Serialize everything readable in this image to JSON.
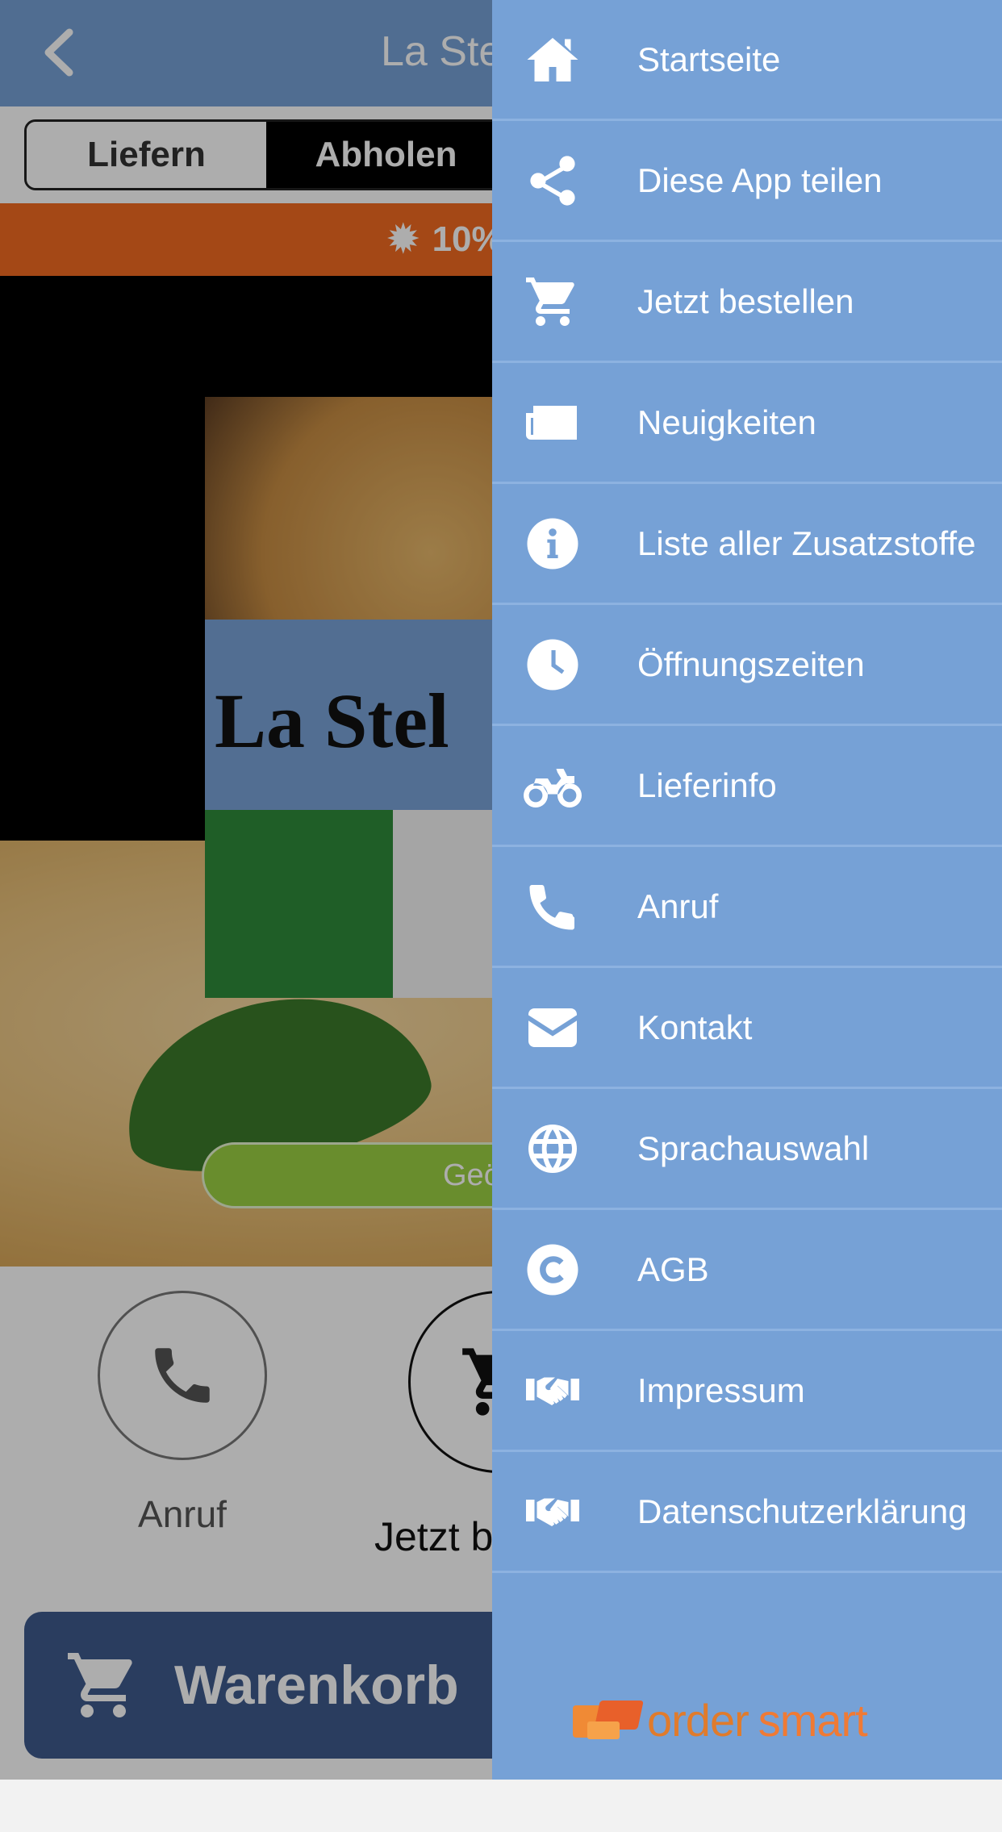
{
  "app": {
    "title": "La Stel",
    "segments": {
      "delivery": "Liefern",
      "pickup": "Abholen"
    },
    "promo_text": "10%",
    "logo_text": "La Stel",
    "hours_button": "Geö",
    "actions": {
      "call": "Anruf",
      "order": "Jetzt b"
    },
    "cart_label": "Warenkorb",
    "colors": {
      "topbar": "#76a1d6",
      "promo": "#f26b21",
      "cart": "#3e5a8c",
      "hours": "#9bd043"
    }
  },
  "drawer": {
    "items": [
      {
        "label": "Startseite",
        "icon": "home-icon"
      },
      {
        "label": "Diese App teilen",
        "icon": "share-icon"
      },
      {
        "label": "Jetzt bestellen",
        "icon": "cart-icon"
      },
      {
        "label": "Neuigkeiten",
        "icon": "newspaper-icon"
      },
      {
        "label": "Liste aller Zusatzstoffe",
        "icon": "info-icon"
      },
      {
        "label": "Öffnungszeiten",
        "icon": "clock-icon"
      },
      {
        "label": "Lieferinfo",
        "icon": "motorcycle-icon"
      },
      {
        "label": "Anruf",
        "icon": "phone-icon"
      },
      {
        "label": "Kontakt",
        "icon": "envelope-icon"
      },
      {
        "label": "Sprachauswahl",
        "icon": "globe-icon"
      },
      {
        "label": "AGB",
        "icon": "copyright-icon"
      },
      {
        "label": "Impressum",
        "icon": "handshake-icon"
      },
      {
        "label": "Datenschutzerklärung",
        "icon": "handshake-icon"
      }
    ],
    "brand": {
      "part1": "order",
      "part2": "smart"
    },
    "color": "#76a1d6"
  }
}
